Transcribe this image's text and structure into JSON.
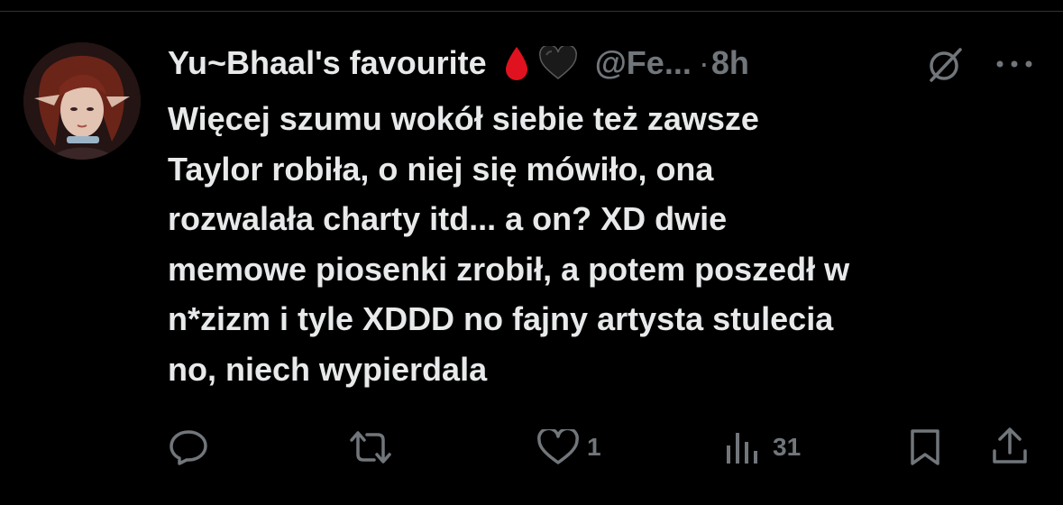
{
  "tweet": {
    "display_name": "Yu~Bhaal's favourite",
    "name_emojis": [
      "blood-drop-icon",
      "black-heart-icon"
    ],
    "handle": "@Fe...",
    "separator": "·",
    "time": "8h",
    "text_lines": [
      "Więcej szumu wokół siebie też zawsze",
      "Taylor robiła, o niej się mówiło, ona",
      "rozwalała charty itd... a on? XD dwie",
      "memowe piosenki zrobił, a potem poszedł w",
      "n*zizm i tyle XDDD no fajny artysta stulecia",
      "no, niech wypierdala"
    ]
  },
  "actions": {
    "reply_count": "",
    "repost_count": "",
    "like_count": "1",
    "views_count": "31"
  },
  "colors": {
    "background": "#000000",
    "text_primary": "#e7e9ea",
    "text_secondary": "#71767b",
    "divider": "#2f3336",
    "blood_drop": "#e0121f"
  }
}
